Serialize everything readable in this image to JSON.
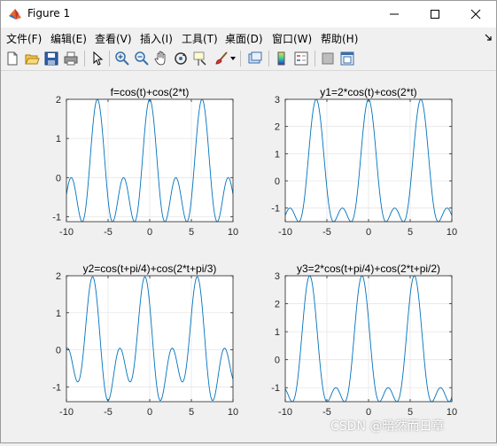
{
  "window": {
    "title": "Figure 1"
  },
  "menu": [
    "文件(F)",
    "编辑(E)",
    "查看(V)",
    "插入(I)",
    "工具(T)",
    "桌面(D)",
    "窗口(W)",
    "帮助(H)"
  ],
  "toolbar": {
    "icons": [
      "new-figure-icon",
      "open-file-icon",
      "save-icon",
      "print-icon",
      "pointer-icon",
      "zoom-in-icon",
      "zoom-out-icon",
      "pan-icon",
      "rotate-3d-icon",
      "data-cursor-icon",
      "brush-icon",
      "link-plot-icon",
      "colorbar-icon",
      "legend-icon",
      "hide-plot-tools-icon",
      "show-plot-tools-icon"
    ]
  },
  "colors": {
    "line": "#0072bd",
    "grid": "#e6e6e6",
    "axes": "#262626"
  },
  "chart_data": [
    {
      "type": "line",
      "title": "f=cos(t)+cos(2*t)",
      "xlim": [
        -10,
        10
      ],
      "ylim": [
        -1.125,
        2
      ],
      "xticks": [
        "-10",
        "-5",
        "0",
        "5",
        "10"
      ],
      "yticks": [
        "-1",
        "0",
        "1",
        "2"
      ],
      "grid": true,
      "function": "cos(t)+cos(2*t)"
    },
    {
      "type": "line",
      "title": "y1=2*cos(t)+cos(2*t)",
      "xlim": [
        -10,
        10
      ],
      "ylim": [
        -1.5,
        3
      ],
      "xticks": [
        "-10",
        "-5",
        "0",
        "5",
        "10"
      ],
      "yticks": [
        "-1",
        "0",
        "1",
        "2",
        "3"
      ],
      "grid": true,
      "function": "2*cos(t)+cos(2*t)"
    },
    {
      "type": "line",
      "title": "y2=cos(t+pi/4)+cos(2*t+pi/3)",
      "xlim": [
        -10,
        10
      ],
      "ylim": [
        -1.4,
        2
      ],
      "xticks": [
        "-10",
        "-5",
        "0",
        "5",
        "10"
      ],
      "yticks": [
        "-1",
        "0",
        "1",
        "2"
      ],
      "grid": true,
      "function": "cos(t+pi/4)+cos(2*t+pi/3)"
    },
    {
      "type": "line",
      "title": "y3=2*cos(t+pi/4)+cos(2*t+pi/2)",
      "xlim": [
        -10,
        10
      ],
      "ylim": [
        -1.5,
        3
      ],
      "xticks": [
        "-10",
        "-5",
        "0",
        "5",
        "10"
      ],
      "yticks": [
        "-1",
        "0",
        "1",
        "2",
        "3"
      ],
      "grid": true,
      "function": "2*cos(t+pi/4)+cos(2*t+pi/2)"
    }
  ],
  "watermark": "CSDN @暗然而日章"
}
